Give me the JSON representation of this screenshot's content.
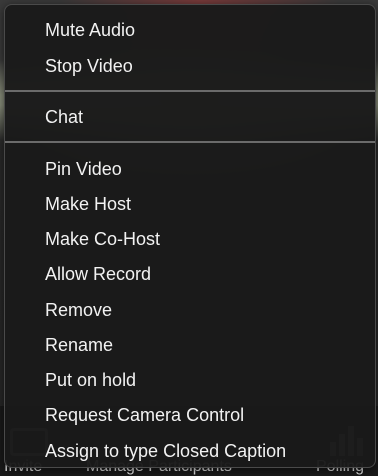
{
  "toolbar": {
    "invite_label": "Invite",
    "manage_participants_label": "Manage Participants",
    "polling_label": "Polling"
  },
  "menu": {
    "items": [
      {
        "label": "Mute Audio"
      },
      {
        "label": "Stop Video"
      },
      {
        "label": "Chat"
      },
      {
        "label": "Pin Video"
      },
      {
        "label": "Make Host"
      },
      {
        "label": "Make Co-Host"
      },
      {
        "label": "Allow Record"
      },
      {
        "label": "Remove"
      },
      {
        "label": "Rename"
      },
      {
        "label": "Put on hold"
      },
      {
        "label": "Request Camera Control"
      },
      {
        "label": "Assign to type Closed Caption"
      }
    ]
  },
  "colors": {
    "menu_background": "#1a1a1a",
    "menu_text": "#f2f2f2",
    "separator": "#6b6b6b"
  }
}
